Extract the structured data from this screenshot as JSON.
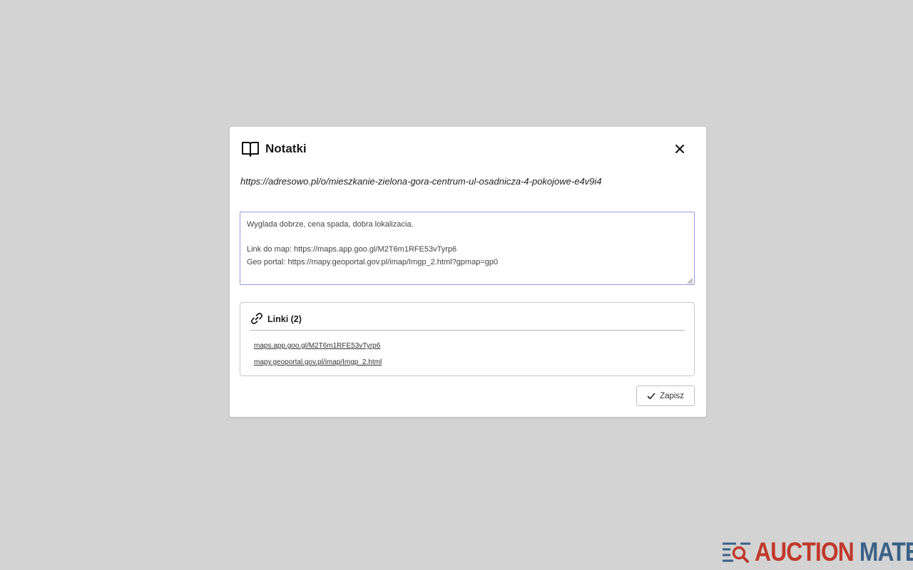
{
  "dialog": {
    "title": "Notatki",
    "icon": "book-open-icon",
    "close_icon": "close-icon",
    "url": "https://adresowo.pl/o/mieszkanie-zielona-gora-centrum-ul-osadnicza-4-pokojowe-e4v9i4"
  },
  "notes": {
    "lines": [
      "Wyglada dobrze, cena spada, dobra lokalizacia.",
      "",
      "Link do map: https://maps.app.goo.gl/M2T6m1RFE53vTyrp6",
      "Geo portal: https://mapy.geoportal.gov.pl/imap/Imgp_2.html?gpmap=gp0"
    ],
    "border_color": "#9b9bdf"
  },
  "links": {
    "title": "Linki (2)",
    "icon": "link-icon",
    "items": [
      "maps.app.goo.gl/M2T6m1RFE53vTyrp6",
      "mapy.geoportal.gov.pl/imap/Imgp_2.html"
    ]
  },
  "actions": {
    "save_label": "Zapisz",
    "save_icon": "check-icon"
  },
  "brand": {
    "word1": "AUCTION",
    "word2": "MATE",
    "color1": "#c0392b",
    "color2": "#3a6186"
  }
}
